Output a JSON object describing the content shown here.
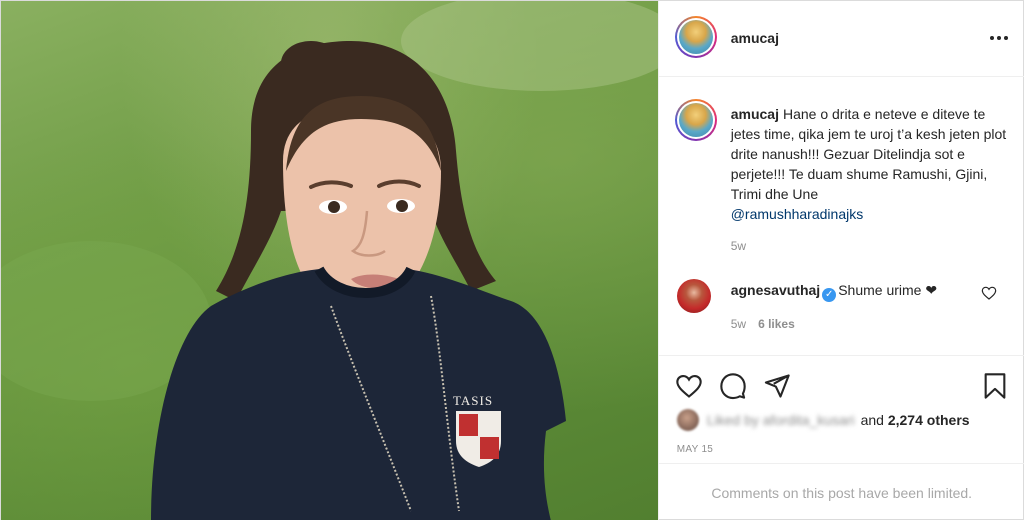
{
  "post": {
    "author": "amucaj",
    "caption_text": "Hane o drita e neteve e diteve te jetes time, qika jem te uroj t’a kesh jeten plot drite nanush!!! Gezuar Ditelindja sot e perjete!!! Te duam shume Ramushi, Gjini, Trimi dhe Une",
    "caption_mention": "@ramushharadinajks",
    "caption_time": "5w",
    "photo_description": "portrait-photo",
    "shirt_text": "TASIS"
  },
  "comment": {
    "user": "agnesavuthaj",
    "text": "Shume urime ❤",
    "time": "5w",
    "likes": "6 likes"
  },
  "likes": {
    "blurred_user": "Liked by afordita_kusari",
    "and_text": "and",
    "others": "2,274 others"
  },
  "date": "MAY 15",
  "footer": {
    "comments_limited": "Comments on this post have been limited."
  },
  "icons": {
    "more": "more-options-icon",
    "heart": "heart-icon",
    "comment": "comment-icon",
    "share": "share-icon",
    "save": "bookmark-icon"
  },
  "colors": {
    "mention": "#00376b",
    "verified": "#3897f0",
    "muted": "#8e8e8e"
  }
}
